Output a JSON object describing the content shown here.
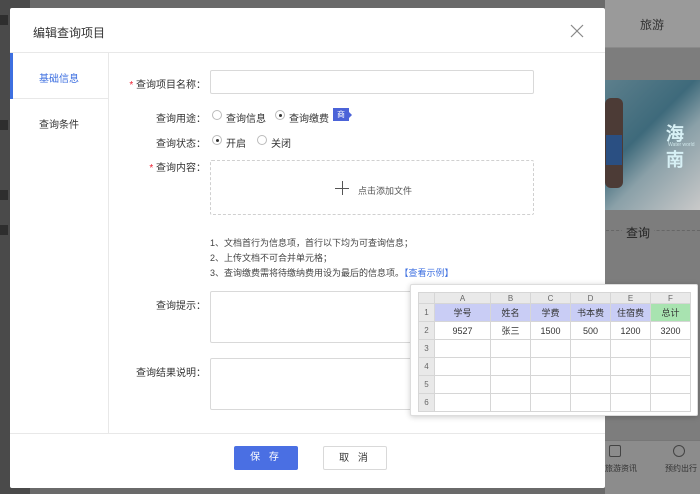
{
  "background": {
    "tab": "旅游",
    "banner_text": "海南",
    "banner_sub": "Water world",
    "query_label": "查询",
    "bottom_left_label": "旅游资讯",
    "bottom_right_label": "预约出行"
  },
  "modal": {
    "title": "编辑查询项目",
    "close_icon": "close-icon"
  },
  "sidebar": {
    "items": [
      {
        "label": "基础信息",
        "active": true
      },
      {
        "label": "查询条件",
        "active": false
      }
    ]
  },
  "form": {
    "name_label": "查询项目名称：",
    "name_value": "",
    "purpose_label": "查询用途：",
    "purpose_options": [
      "查询信息",
      "查询缴费"
    ],
    "purpose_selected": "查询缴费",
    "purpose_badge": "商",
    "status_label": "查询状态：",
    "status_options": [
      "开启",
      "关闭"
    ],
    "status_selected": "开启",
    "content_label": "查询内容：",
    "upload_text": "点击添加文件",
    "notes": [
      "1、文档首行为信息项，首行以下均为可查询信息；",
      "2、上传文档不可合并单元格；",
      "3、查询缴费需将待缴纳费用设为最后的信息项。"
    ],
    "example_link": "【查看示例】",
    "hint_label": "查询提示：",
    "result_label": "查询结果说明："
  },
  "footer": {
    "save": "保 存",
    "cancel": "取 消"
  },
  "example": {
    "columns": [
      "A",
      "B",
      "C",
      "D",
      "E",
      "F"
    ],
    "rows": [
      [
        "1",
        "学号",
        "姓名",
        "学费",
        "书本费",
        "住宿费",
        "总计"
      ],
      [
        "2",
        "9527",
        "张三",
        "1500",
        "500",
        "1200",
        "3200"
      ],
      [
        "3",
        "",
        "",
        "",
        "",
        "",
        ""
      ],
      [
        "4",
        "",
        "",
        "",
        "",
        "",
        ""
      ],
      [
        "5",
        "",
        "",
        "",
        "",
        "",
        ""
      ],
      [
        "6",
        "",
        "",
        "",
        "",
        "",
        ""
      ]
    ],
    "header_color": "#c9cdf5",
    "total_color": "#a8e3b0"
  }
}
